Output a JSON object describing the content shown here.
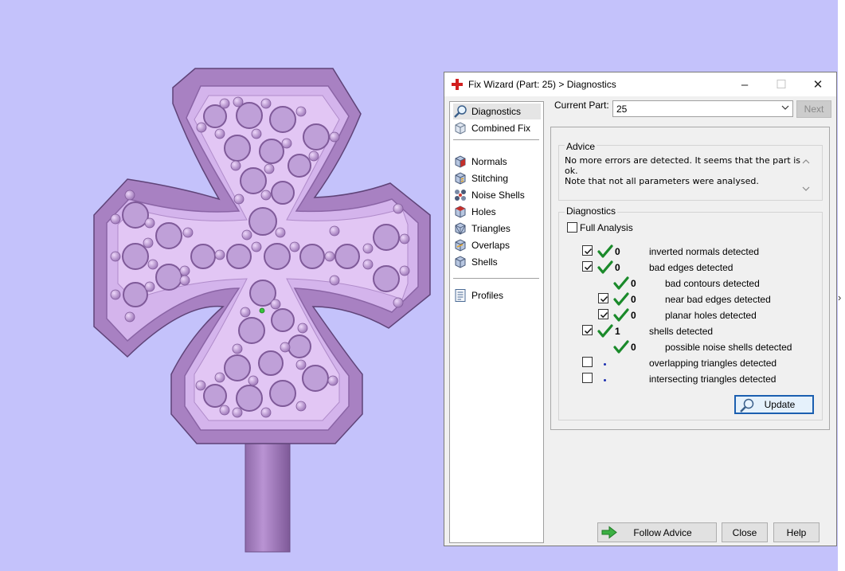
{
  "colors": {
    "viewport_background": "#c4c2fb",
    "part_color": "#c9a0e2",
    "check_green": "#1a8a2a",
    "dot_blue": "#1c2fb0",
    "focus_border": "#1b5fb0"
  },
  "dialog": {
    "title": "Fix Wizard (Part: 25) > Diagnostics",
    "title_icon": "red-cross-icon",
    "window_buttons": {
      "minimize": "–",
      "maximize": "☐",
      "close": "✕"
    }
  },
  "nav": {
    "items": [
      {
        "label": "Diagnostics",
        "icon": "magnifier-icon",
        "active": true
      },
      {
        "label": "Combined Fix",
        "icon": "cube-icon"
      },
      {
        "label": "Normals",
        "icon": "normals-cube-icon"
      },
      {
        "label": "Stitching",
        "icon": "stitching-cube-icon"
      },
      {
        "label": "Noise Shells",
        "icon": "noise-shells-icon"
      },
      {
        "label": "Holes",
        "icon": "holes-cube-icon"
      },
      {
        "label": "Triangles",
        "icon": "triangles-cube-icon"
      },
      {
        "label": "Overlaps",
        "icon": "overlaps-cube-icon"
      },
      {
        "label": "Shells",
        "icon": "shells-cube-icon"
      },
      {
        "label": "Profiles",
        "icon": "profiles-document-icon"
      }
    ]
  },
  "current_part": {
    "label": "Current Part:",
    "value": "25"
  },
  "next_label": "Next",
  "advice": {
    "title": "Advice",
    "lines": [
      "No more errors are detected. It seems that the part is ok.",
      "Note that not all parameters were analysed."
    ]
  },
  "diagnostics": {
    "title": "Diagnostics",
    "full_analysis_label": "Full Analysis",
    "full_analysis_checked": false,
    "rows": [
      {
        "count": "0",
        "label": "inverted normals detected",
        "checkbox": true,
        "checked": true,
        "status": "ok"
      },
      {
        "count": "0",
        "label": "bad edges detected",
        "checkbox": true,
        "checked": true,
        "status": "ok"
      },
      {
        "count": "0",
        "label": "bad contours detected",
        "checkbox": false,
        "checked": false,
        "status": "ok"
      },
      {
        "count": "0",
        "label": "near bad edges detected",
        "checkbox": true,
        "checked": true,
        "status": "ok"
      },
      {
        "count": "0",
        "label": "planar holes detected",
        "checkbox": true,
        "checked": true,
        "status": "ok"
      },
      {
        "count": "1",
        "label": "shells detected",
        "checkbox": true,
        "checked": true,
        "status": "ok"
      },
      {
        "count": "0",
        "label": "possible noise shells detected",
        "checkbox": false,
        "checked": false,
        "status": "ok"
      },
      {
        "count": "",
        "label": "overlapping triangles detected",
        "checkbox": true,
        "checked": false,
        "status": "not-analysed"
      },
      {
        "count": "",
        "label": "intersecting triangles detected",
        "checkbox": true,
        "checked": false,
        "status": "not-analysed"
      }
    ]
  },
  "buttons": {
    "update": "Update",
    "follow_advice": "Follow Advice",
    "close": "Close",
    "help": "Help"
  }
}
